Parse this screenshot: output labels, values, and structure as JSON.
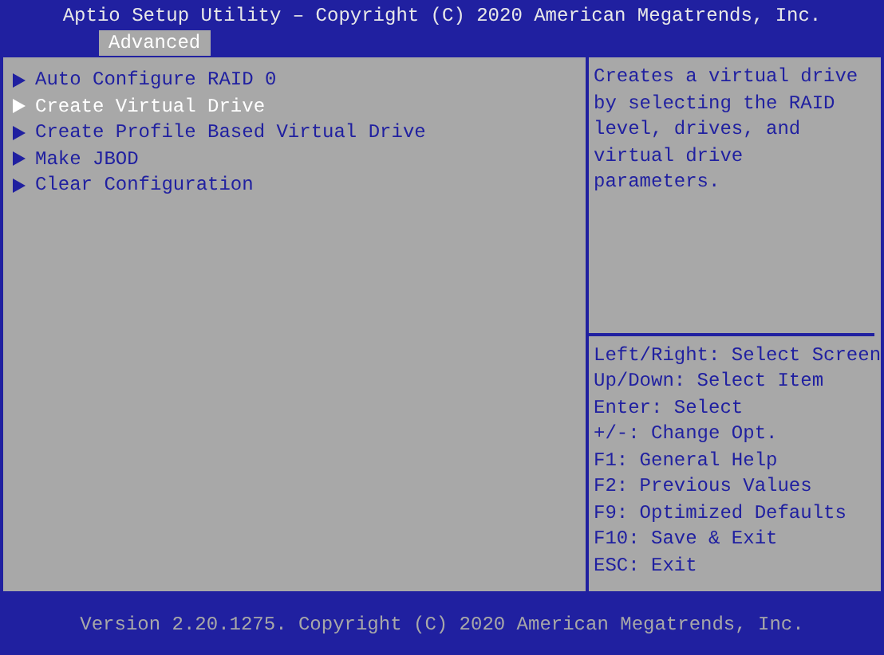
{
  "header": {
    "title": "Aptio Setup Utility – Copyright (C) 2020 American Megatrends, Inc.",
    "tabs": [
      {
        "label": "Advanced",
        "selected": true
      }
    ]
  },
  "menu": [
    {
      "label": "Auto Configure RAID 0",
      "selected": false
    },
    {
      "label": "Create Virtual Drive",
      "selected": true
    },
    {
      "label": "Create Profile Based Virtual Drive",
      "selected": false
    },
    {
      "label": "Make JBOD",
      "selected": false
    },
    {
      "label": "Clear Configuration",
      "selected": false
    }
  ],
  "help_text": [
    "Creates a virtual drive",
    "by selecting the RAID",
    "level, drives, and",
    "virtual drive",
    "parameters."
  ],
  "key_help": [
    "Left/Right: Select Screen",
    "Up/Down: Select Item",
    "Enter: Select",
    "+/-: Change Opt.",
    "F1: General Help",
    "F2: Previous Values",
    "F9: Optimized Defaults",
    "F10: Save & Exit",
    "ESC: Exit"
  ],
  "footer": "Version 2.20.1275. Copyright (C) 2020 American Megatrends, Inc."
}
